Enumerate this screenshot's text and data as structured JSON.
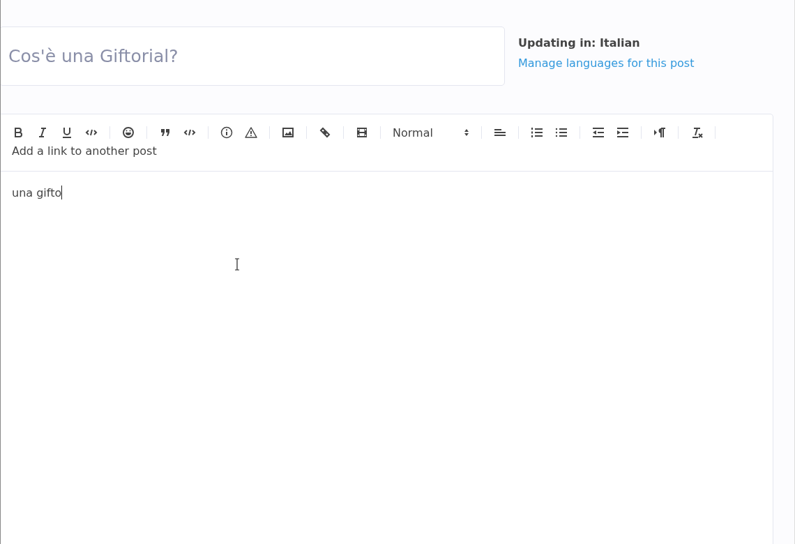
{
  "title_field": {
    "placeholder": "Cos'è una Giftorial?"
  },
  "language": {
    "label": "Updating in: Italian",
    "link": "Manage languages for this post"
  },
  "toolbar": {
    "format_select": "Normal",
    "link_post": "Add a link to another post"
  },
  "editor": {
    "value": "una gifto"
  }
}
